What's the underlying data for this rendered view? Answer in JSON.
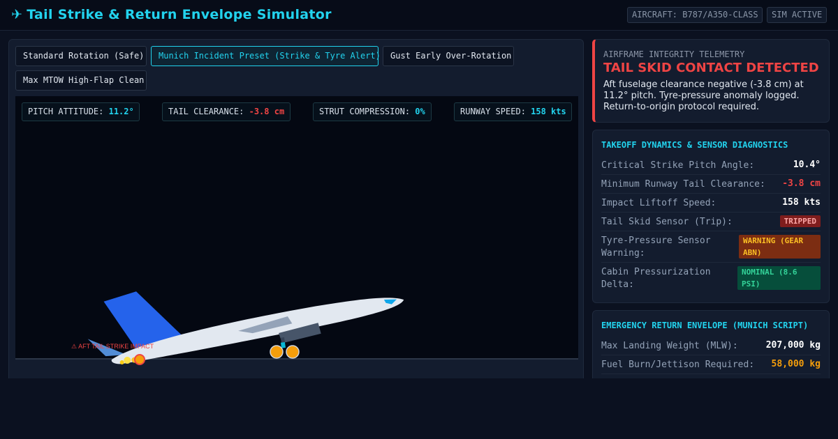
{
  "header": {
    "icon": "airplane-icon",
    "title": "Tail Strike & Return Envelope Simulator",
    "aircraft_chip": "AIRCRAFT: B787/A350-CLASS",
    "sim_chip": "SIM ACTIVE"
  },
  "presets": [
    {
      "label": "Standard Rotation (Safe)",
      "active": false
    },
    {
      "label": "Munich Incident Preset (Strike & Tyre Alert)",
      "active": true
    },
    {
      "label": "Gust Early Over-Rotation",
      "active": false
    },
    {
      "label": "Max MTOW High-Flap Clean",
      "active": false
    }
  ],
  "telemetry": {
    "pitch_label": "PITCH ATTITUDE:",
    "pitch_value": "11.2°",
    "pitch_deg": 11.2,
    "tail_label": "TAIL CLEARANCE:",
    "tail_value": "-3.8 cm",
    "strut_label": "STRUT COMPRESSION:",
    "strut_value": "0%",
    "speed_label": "RUNWAY SPEED:",
    "speed_value": "158 kts"
  },
  "scene": {
    "impact_label": "⚠ AFT TAIL STRIKE IMPACT"
  },
  "alert": {
    "kicker": "AIRFRAME INTEGRITY TELEMETRY",
    "headline": "TAIL SKID CONTACT DETECTED",
    "body": "Aft fuselage clearance negative (-3.8 cm) at 11.2° pitch. Tyre-pressure anomaly logged. Return-to-origin protocol required."
  },
  "diagnostics": {
    "title": "TAKEOFF DYNAMICS & SENSOR DIAGNOSTICS",
    "rows": [
      {
        "label": "Critical Strike Pitch Angle:",
        "value": "10.4°"
      },
      {
        "label": "Minimum Runway Tail Clearance:",
        "value": "-3.8 cm"
      },
      {
        "label": "Impact Liftoff Speed:",
        "value": "158 kts"
      },
      {
        "label": "Tail Skid Sensor (Trip):",
        "value": "TRIPPED"
      },
      {
        "label": "Tyre-Pressure Sensor Warning:",
        "value": "WARNING (GEAR ABN)"
      },
      {
        "label": "Cabin Pressurization Delta:",
        "value": "NOMINAL (8.6 PSI)"
      }
    ]
  },
  "return_envelope": {
    "title": "EMERGENCY RETURN ENVELOPE (MUNICH SCRIPT)",
    "rows": [
      {
        "label": "Max Landing Weight (MLW):",
        "value": "207,000 kg"
      },
      {
        "label": "Fuel Burn/Jettison Required:",
        "value": "58,000 kg"
      }
    ]
  },
  "colors": {
    "accent": "#22d3ee",
    "danger": "#ef4444",
    "warning": "#f59e0b",
    "ok": "#34d399",
    "tail_fin": "#2563eb",
    "fuselage": "#e2e8f0"
  }
}
